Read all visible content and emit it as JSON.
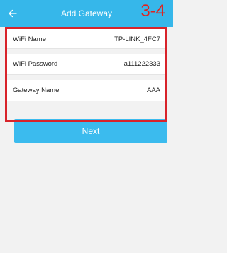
{
  "header": {
    "title": "Add Gateway",
    "step": "3-4",
    "back_icon": "arrow-left-icon"
  },
  "form": {
    "wifi_name": {
      "label": "WiFi Name",
      "value": "TP-LINK_4FC7"
    },
    "wifi_password": {
      "label": "WiFi Password",
      "value": "a111222333"
    },
    "gateway_name": {
      "label": "Gateway Name",
      "value": "AAA"
    }
  },
  "actions": {
    "next_label": "Next"
  },
  "colors": {
    "header": "#36b7ea",
    "button": "#3bbbee",
    "highlight": "#d8232a",
    "background": "#f2f2f2"
  }
}
